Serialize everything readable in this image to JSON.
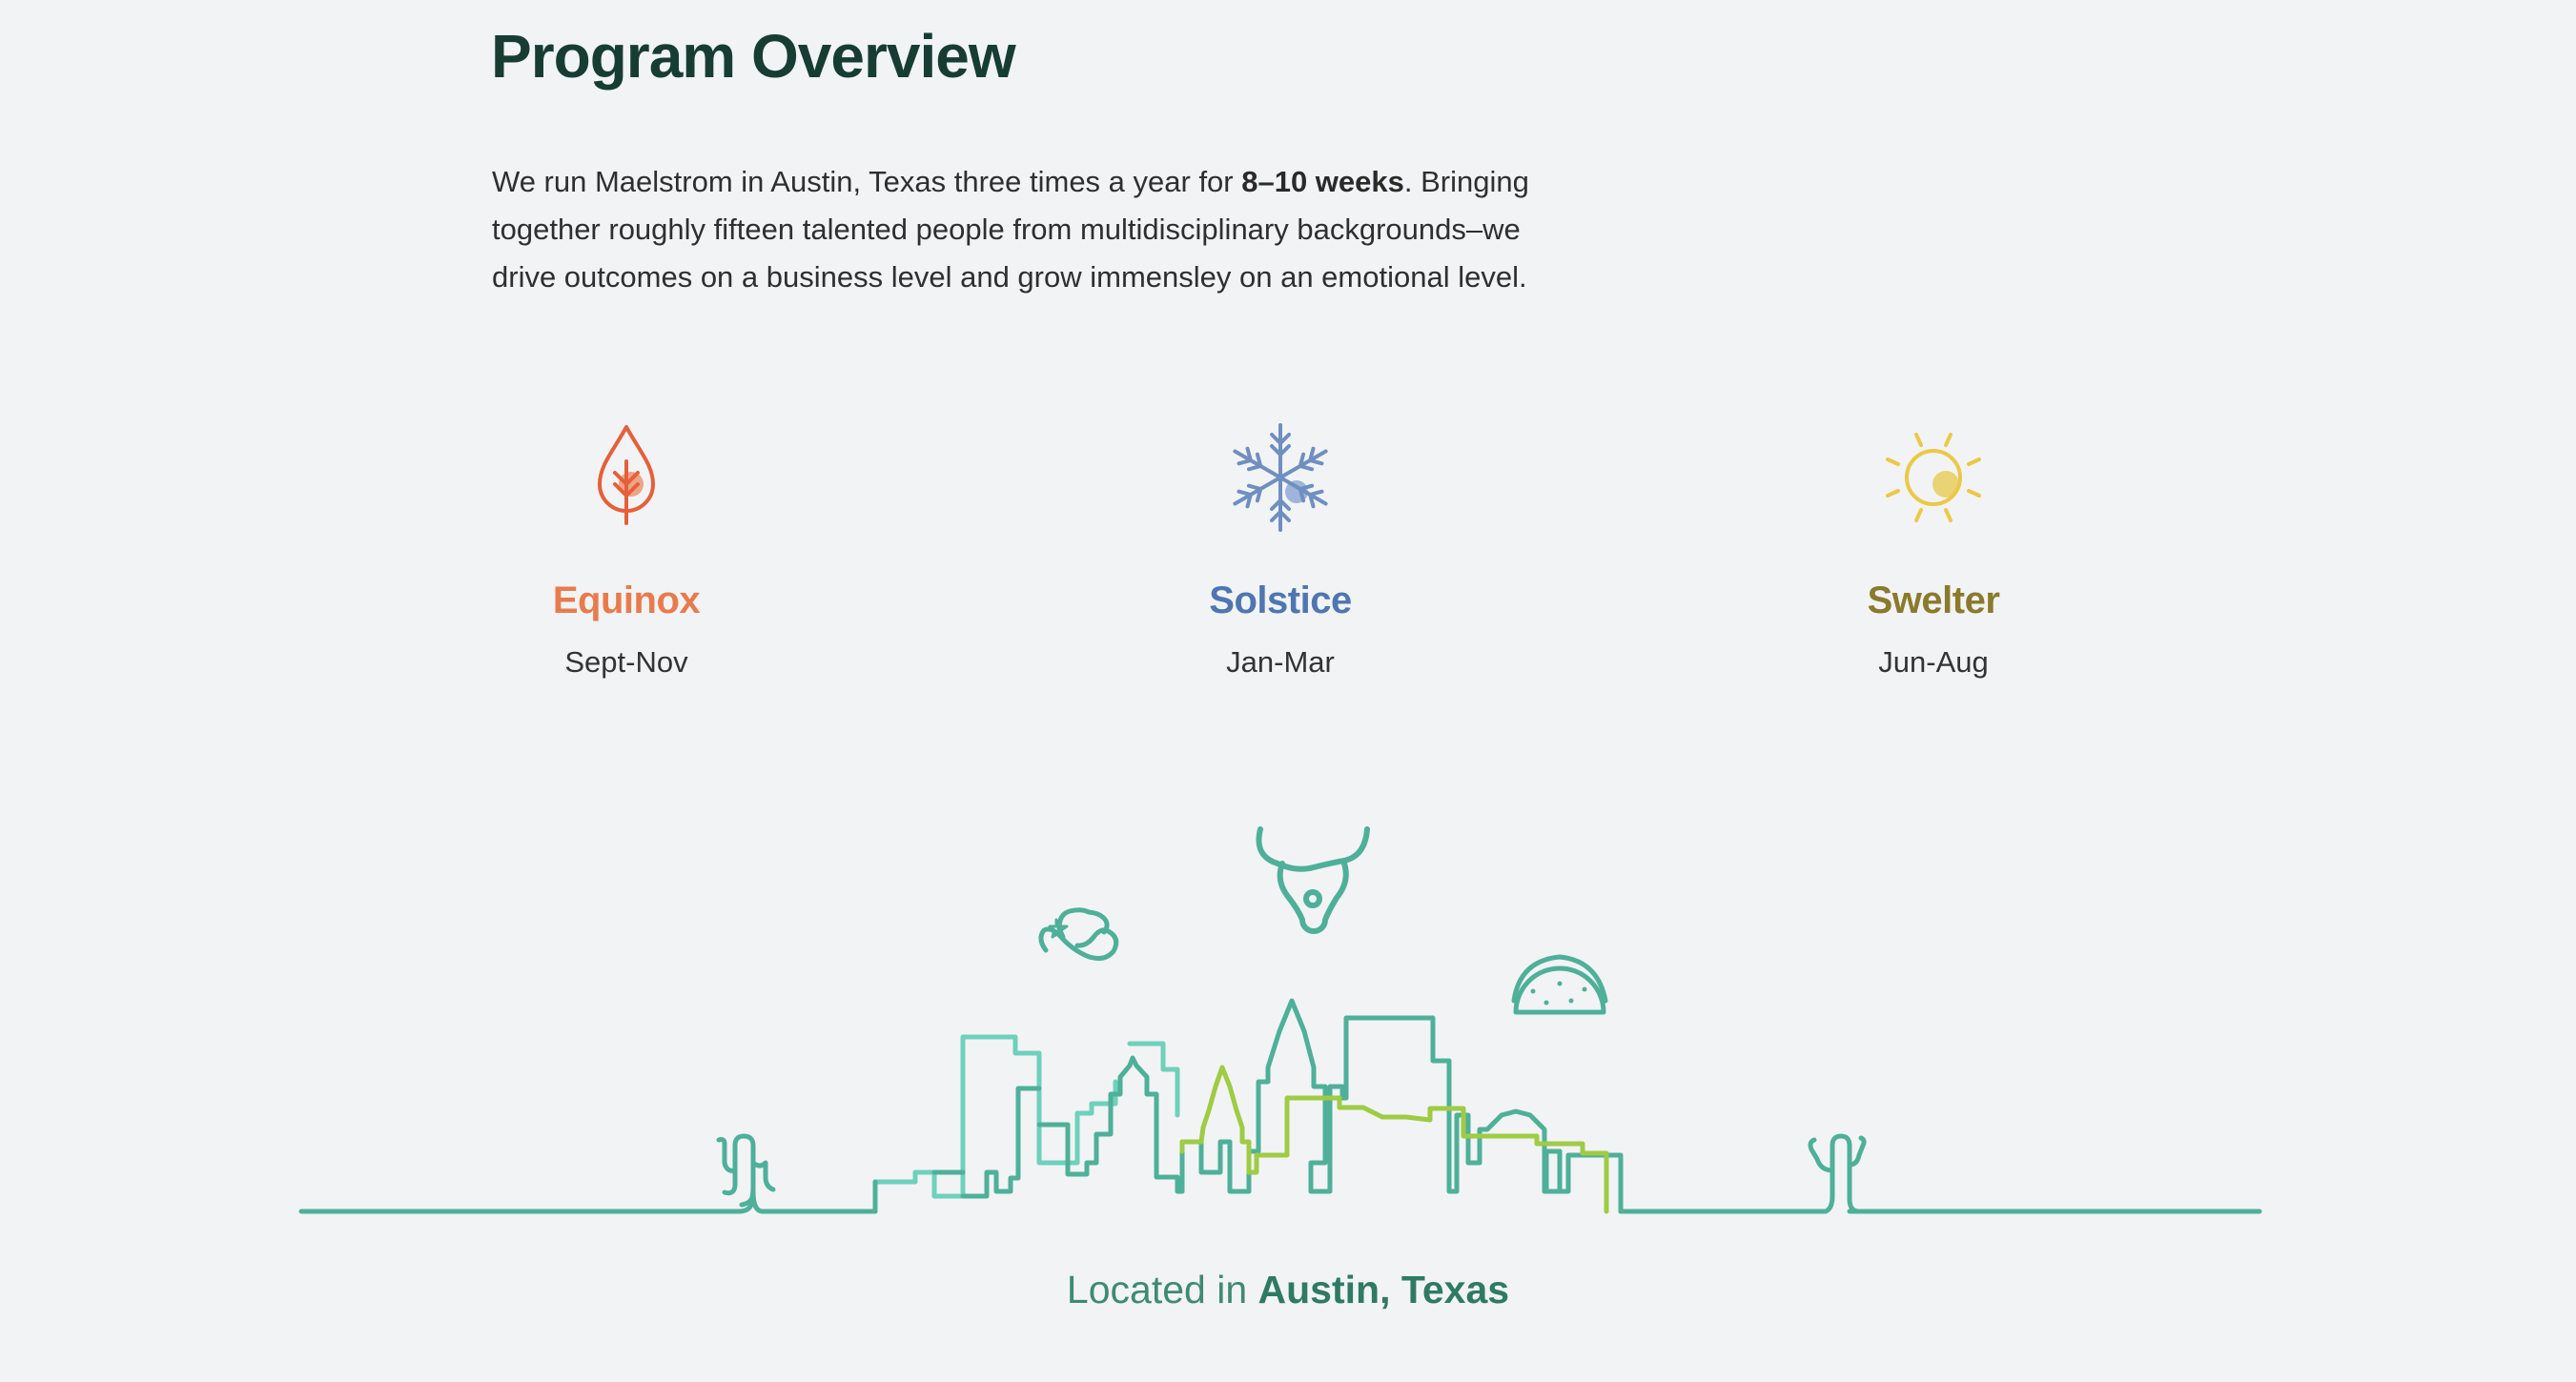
{
  "page": {
    "title": "Program Overview",
    "intro": {
      "before": "We run Maelstrom in Austin, Texas three times a year for ",
      "emphasis": "8–10 weeks",
      "after": ". Bringing together roughly fifteen talented people from multidisciplinary backgrounds–we drive outcomes on a business level and grow immensley on an emotional level."
    }
  },
  "seasons": [
    {
      "name": "Equinox",
      "months": "Sept-Nov",
      "icon": "leaf-drop-icon",
      "color": "#e87b4c"
    },
    {
      "name": "Solstice",
      "months": "Jan-Mar",
      "icon": "snowflake-icon",
      "color": "#4f76b0"
    },
    {
      "name": "Swelter",
      "months": "Jun-Aug",
      "icon": "sun-icon",
      "color": "#8a7a2c"
    }
  ],
  "location": {
    "prefix": "Located in ",
    "place": "Austin, Texas"
  },
  "illustration": {
    "icons": [
      "cowboy-hat-icon",
      "longhorn-icon",
      "taco-icon",
      "cactus-icon",
      "austin-skyline-icon"
    ],
    "colors": {
      "teal": "#4fb09a",
      "light_teal": "#6fd0bc",
      "lime": "#9fcb45"
    }
  }
}
